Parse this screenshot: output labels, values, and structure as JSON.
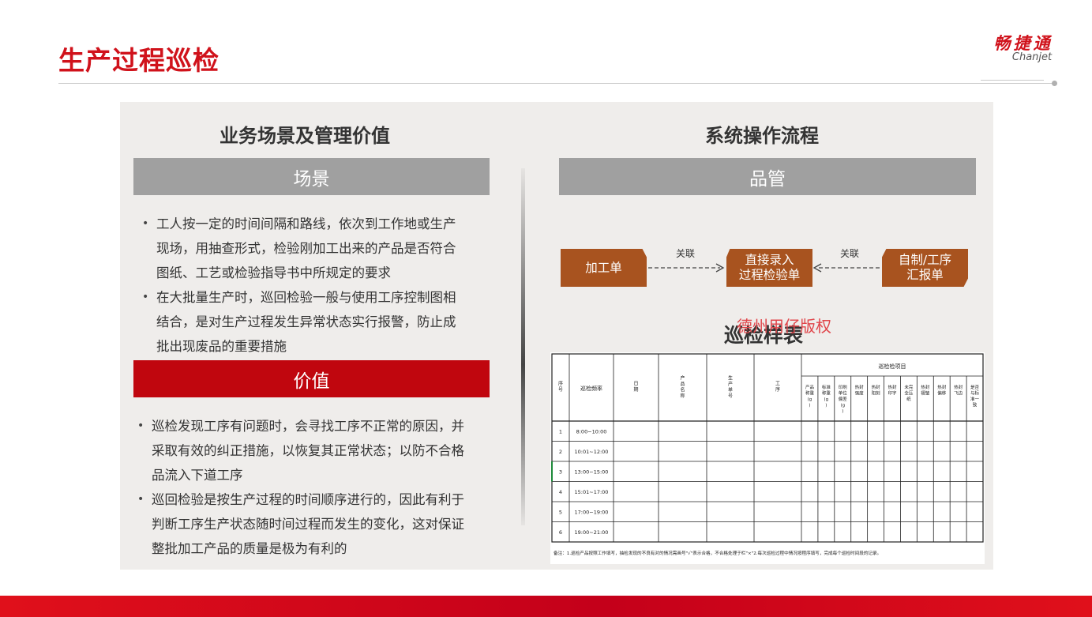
{
  "page": {
    "title": "生产过程巡检"
  },
  "logo": {
    "cn": "畅捷通",
    "en": "Chanjet"
  },
  "left": {
    "heading": "业务场景及管理价值",
    "scene_label": "场景",
    "scene_items": [
      [
        "工人按一定的时间间隔和路线，依次到工作地或生产",
        "现场，用抽查形式，检验刚加工出来的产品是否符合",
        "图纸、工艺或检验指导书中所规定的要求"
      ],
      [
        "在大批量生产时，巡回检验一般与使用工序控制图相",
        "结合，是对生产过程发生异常状态实行报警，防止成",
        "批出现废品的重要措施"
      ]
    ],
    "value_label": "价值",
    "value_items": [
      [
        "巡检发现工序有问题时，会寻找工序不正常的原因，并",
        "采取有效的纠正措施，以恢复其正常状态；以防不合格",
        "品流入下道工序"
      ],
      [
        "巡回检验是按生产过程的时间顺序进行的，因此有利于",
        "判断工序生产状态随时间过程而发生的变化，这对保证",
        "整批加工产品的质量是极为有利的"
      ]
    ]
  },
  "right": {
    "heading": "系统操作流程",
    "qc_label": "品管",
    "flow": {
      "box1": "加工单",
      "box2": [
        "直接录入",
        "过程检验单"
      ],
      "box3": [
        "自制/工序",
        "汇报单"
      ],
      "link1": "关联",
      "link2": "关联"
    },
    "watermark": "德州用仔版权",
    "sample_title": "巡检样表"
  },
  "sample_table": {
    "headers": [
      "序号",
      "巡检频率",
      "日期",
      "产品名称",
      "生产单号",
      "工序",
      "巡检检项目"
    ],
    "sub_headers": [
      "产品称重(g)",
      "标准称重(g)",
      "印刷单位偏差(g)",
      "热封强度",
      "热封阳刻",
      "热封印字",
      "未完全压纸",
      "热封褶皱",
      "热封偏移",
      "热封飞边",
      "是否与标准一致"
    ],
    "rows": [
      [
        "1",
        "8:00~10:00"
      ],
      [
        "2",
        "10:01~12:00"
      ],
      [
        "3",
        "13:00~15:00"
      ],
      [
        "4",
        "15:01~17:00"
      ],
      [
        "5",
        "17:00~19:00"
      ],
      [
        "6",
        "19:00~21:00"
      ]
    ],
    "note": "备注：1.巡检产品按照工作填写，抽检发现的不良有对的情况需画号\"√\"表示合格，不合格处理于栏\"×\"2.每次巡检过程中情况按程序填写，完成每个巡检时间段的记录。"
  },
  "colors": {
    "brand_red": "#d0121b",
    "value_red": "#c0060e",
    "flow_brown": "#a8531f",
    "panel_bg": "#efedeb",
    "scene_gray": "#a0a0a0"
  }
}
